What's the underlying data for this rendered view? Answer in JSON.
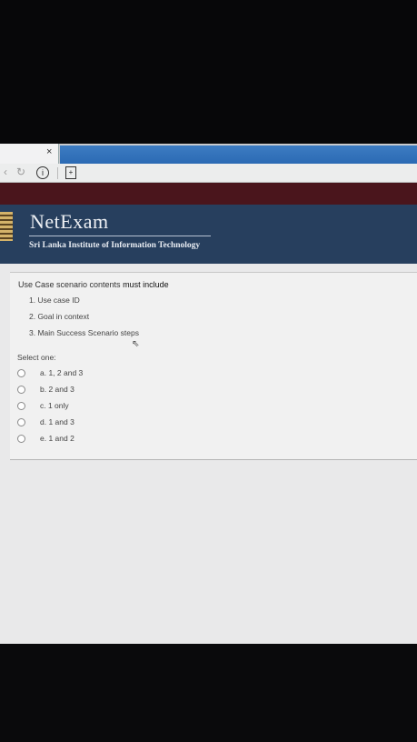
{
  "browser": {
    "tab_close": "×",
    "info_icon": "i",
    "extension_icon": "+"
  },
  "header": {
    "brand": "NetExam",
    "subtitle": "Sri Lanka Institute of Information Technology"
  },
  "question": {
    "text_prefix": "Use Case scenario contents ",
    "text_emphasis": "must include",
    "items": [
      "1. Use case ID",
      "2. Goal in context",
      "3. Main Success Scenario steps"
    ],
    "select_label": "Select one:",
    "options": [
      "a. 1, 2 and 3",
      "b. 2 and 3",
      "c. 1 only",
      "d. 1 and 3",
      "e. 1 and 2"
    ]
  },
  "colors": {
    "header_bg": "#273f5e",
    "dark_strip": "#4a151c",
    "tab_blue": "#2b6ab4"
  }
}
